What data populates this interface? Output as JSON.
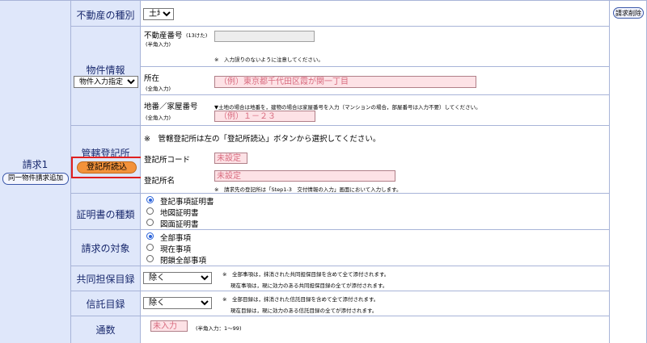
{
  "form": {
    "request_label": "請求1",
    "add_same_property_button": "同一物件請求追加",
    "delete_request_button": "請求削除",
    "property_type": {
      "label": "不動産の種別",
      "selected": "土地",
      "options": [
        "土地"
      ]
    },
    "property_info": {
      "label": "物件情報",
      "mode_selected": "物件入力指定",
      "mode_options": [
        "物件入力指定"
      ],
      "number": {
        "label": "不動産番号",
        "digits_note": "(13けた)",
        "input_note": "(半角入力)",
        "value": "",
        "warning": "※　入力誤りのないように注意してください。"
      },
      "location": {
        "label": "所在",
        "input_note": "(全角入力)",
        "placeholder": "（例）東京都千代田区霞が関一丁目"
      },
      "lot_number": {
        "label": "地番／家屋番号",
        "input_note": "(全角入力)",
        "placeholder": "（例）１－２３",
        "note": "▼土地の場合は地番を，建物の場合は家屋番号を入力（マンションの場合，部屋番号は入力不要）してください。"
      }
    },
    "registry_office": {
      "label": "管轄登記所",
      "read_button": "登記所読込",
      "instruction": "※　管轄登記所は左の「登記所読込」ボタンから選択してください。",
      "code_label": "登記所コード",
      "code_value": "未設定",
      "name_label": "登記所名",
      "name_value": "未設定",
      "name_note": "※　請求先の登記所は「Step1-3　交付情報の入力」画面において入力します。"
    },
    "certificate_type": {
      "label": "証明書の種類",
      "options": [
        "登記事項証明書",
        "地図証明書",
        "図面証明書"
      ],
      "selected_index": 0
    },
    "request_target": {
      "label": "請求の対象",
      "options": [
        "全部事項",
        "現在事項",
        "閉鎖全部事項"
      ],
      "selected_index": 0
    },
    "joint_collateral": {
      "label": "共同担保目録",
      "selected": "除く",
      "options": [
        "除く"
      ],
      "note1": "※　全部事項は，抹消された共同担保目録を含めて全て添付されます。",
      "note2": "現在事項は，現に効力のある共同担保目録の全てが添付されます。"
    },
    "trust": {
      "label": "信託目録",
      "selected": "除く",
      "options": [
        "除く"
      ],
      "note1": "※　全部目録は，抹消された信託目録を含めて全て添付されます。",
      "note2": "現在目録は，現に効力のある信託目録の全てが添付されます。"
    },
    "copies": {
      "label": "通数",
      "value": "未入力",
      "note": "(半角入力：1～99)"
    }
  }
}
